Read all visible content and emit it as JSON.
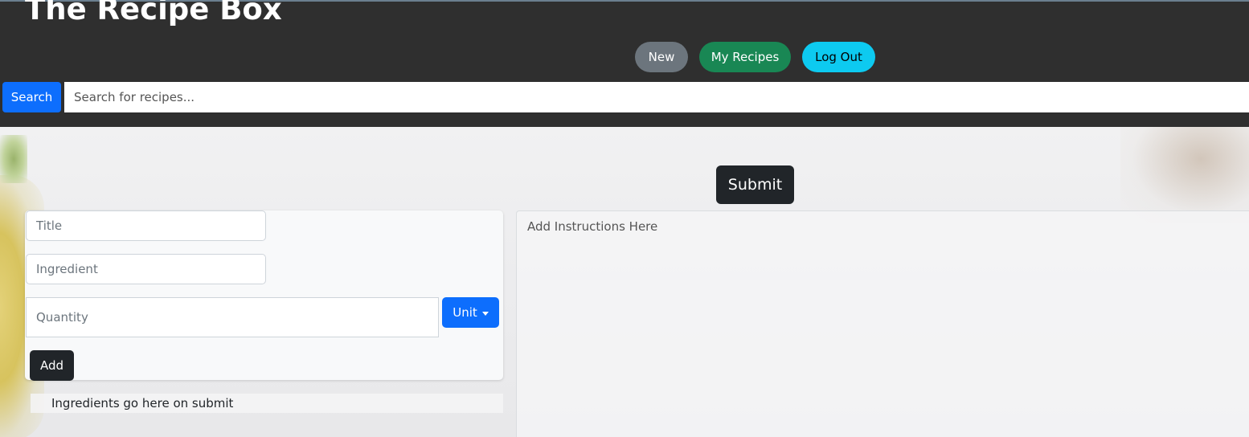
{
  "header": {
    "app_title": "The Recipe Box",
    "nav": {
      "new_label": "New",
      "my_recipes_label": "My Recipes",
      "log_out_label": "Log Out"
    },
    "search": {
      "button_label": "Search",
      "placeholder": "Search for recipes..."
    }
  },
  "main": {
    "submit_label": "Submit",
    "form": {
      "title_placeholder": "Title",
      "ingredient_placeholder": "Ingredient",
      "quantity_placeholder": "Quantity",
      "unit_label": "Unit",
      "add_label": "Add"
    },
    "ingredients_text": "Ingredients go here on submit",
    "instructions_placeholder": "Add Instructions Here"
  },
  "colors": {
    "header_bg": "#2f2f2f",
    "new_button": "#6c757d",
    "my_recipes_button": "#198754",
    "log_out_button": "#0dcaf0",
    "primary": "#0d6efd",
    "dark": "#212529"
  }
}
